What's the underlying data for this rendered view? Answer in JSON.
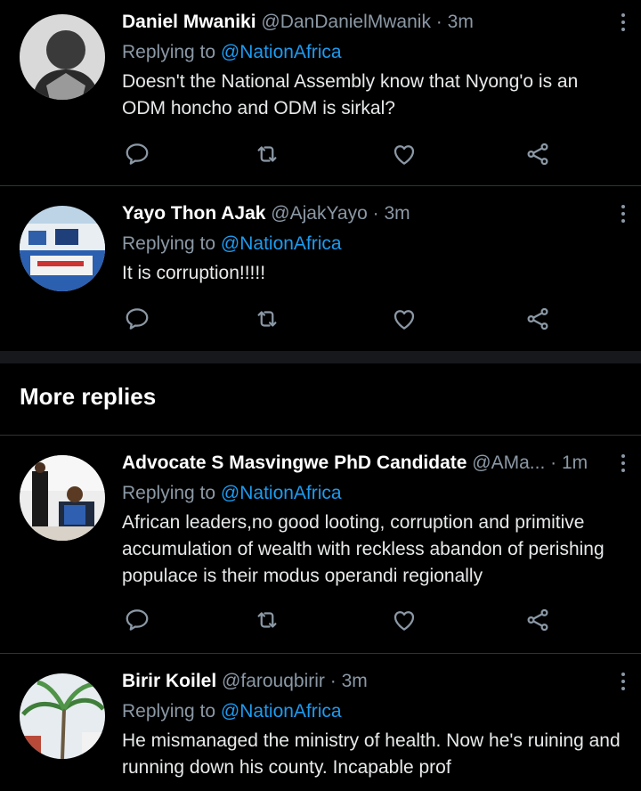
{
  "tweets": [
    {
      "name": "Daniel Mwaniki",
      "handle": "@DanDanielMwanik",
      "dot": "·",
      "time": "3m",
      "replying_prefix": "Replying to ",
      "replying_to": "@NationAfrica",
      "text": "Doesn't the National Assembly know that Nyong'o is an ODM honcho and ODM is sirkal?"
    },
    {
      "name": "Yayo Thon AJak",
      "handle": "@AjakYayo",
      "dot": "·",
      "time": "3m",
      "replying_prefix": "Replying to ",
      "replying_to": "@NationAfrica",
      "text": "It is corruption!!!!!"
    },
    {
      "name": "Advocate S Masvingwe PhD Candidate",
      "handle": "@AMa...",
      "dot": "·",
      "time": "1m",
      "replying_prefix": "Replying to ",
      "replying_to": "@NationAfrica",
      "text": "African leaders,no good looting, corruption and primitive accumulation of wealth with reckless abandon of perishing populace is their modus operandi regionally"
    },
    {
      "name": "Birir Koilel",
      "handle": "@farouqbirir",
      "dot": "·",
      "time": "3m",
      "replying_prefix": "Replying to ",
      "replying_to": "@NationAfrica",
      "text": "He mismanaged the ministry of health. Now he's ruining and running down his county. Incapable prof"
    }
  ],
  "section": {
    "more_replies": "More replies"
  },
  "icons": {
    "reply": "reply-icon",
    "retweet": "retweet-icon",
    "like": "heart-icon",
    "share": "share-icon",
    "more": "more-vertical-icon"
  },
  "colors": {
    "background": "#000000",
    "text": "#e7e9ea",
    "secondary": "#8b98a5",
    "link": "#1d9bf0",
    "divider": "#2f3336"
  }
}
